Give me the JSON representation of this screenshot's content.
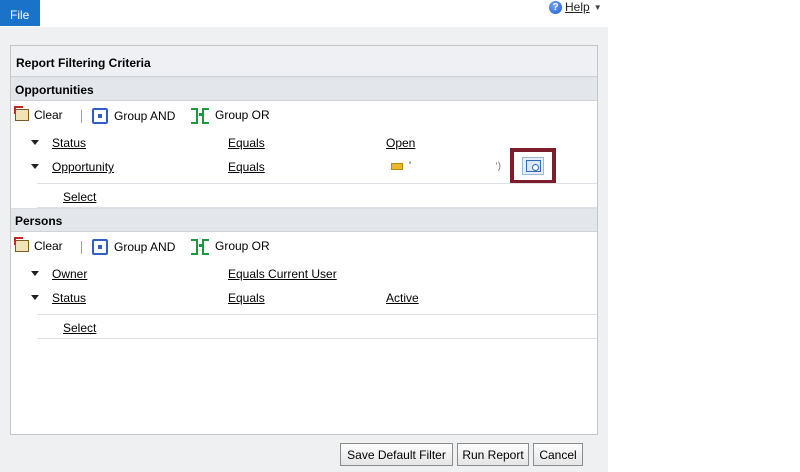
{
  "menu": {
    "file_label": "File"
  },
  "help": {
    "label": "Help"
  },
  "dialog": {
    "title": "Report Filtering Criteria",
    "sections": [
      {
        "name": "Opportunities",
        "toolbar": {
          "clear": "Clear",
          "group_and": "Group AND",
          "group_or": "Group OR"
        },
        "conditions": [
          {
            "field": "Status",
            "operator": "Equals",
            "value": "Open"
          },
          {
            "field": "Opportunity",
            "operator": "Equals",
            "value": "'"
          }
        ],
        "select_label": "Select"
      },
      {
        "name": "Persons",
        "toolbar": {
          "clear": "Clear",
          "group_and": "Group AND",
          "group_or": "Group OR"
        },
        "conditions": [
          {
            "field": "Owner",
            "operator": "Equals Current User",
            "value": ""
          },
          {
            "field": "Status",
            "operator": "Equals",
            "value": "Active"
          }
        ],
        "select_label": "Select"
      }
    ],
    "lookup_marker": "‘)",
    "buttons": {
      "save_default": "Save Default Filter",
      "run": "Run Report",
      "cancel": "Cancel"
    }
  },
  "colors": {
    "file_tab": "#1b73c9",
    "highlight_frame": "#7d1d2b"
  }
}
